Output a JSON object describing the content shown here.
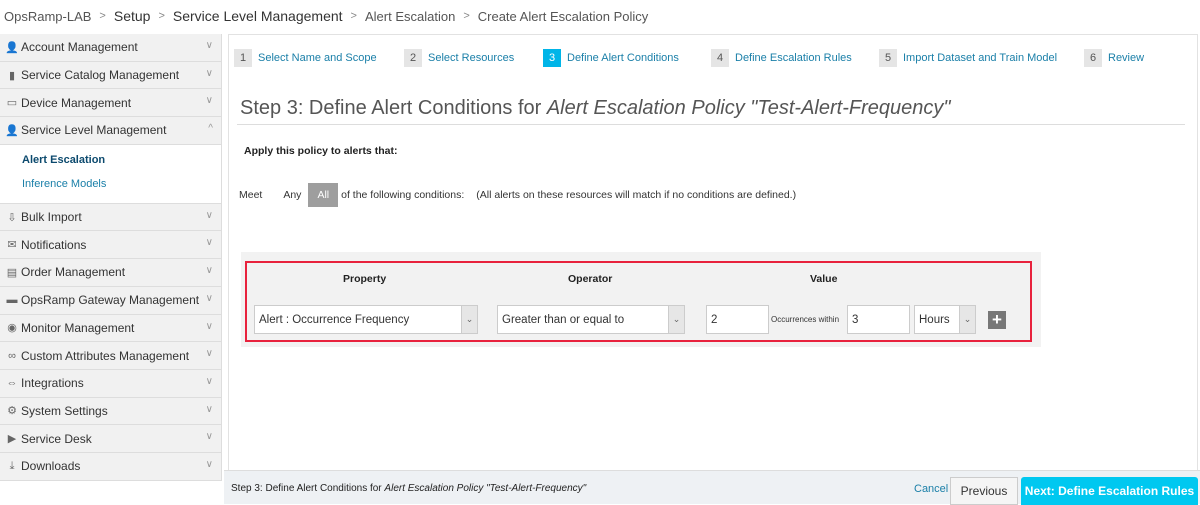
{
  "breadcrumb": [
    "OpsRamp-LAB",
    "Setup",
    "Service Level Management",
    "Alert Escalation",
    "Create Alert Escalation Policy"
  ],
  "sidebar": {
    "items": [
      {
        "label": "Account Management",
        "icon": "user-icon",
        "expanded": false
      },
      {
        "label": "Service Catalog Management",
        "icon": "document-icon",
        "expanded": false
      },
      {
        "label": "Device Management",
        "icon": "monitor-icon",
        "expanded": false
      },
      {
        "label": "Service Level Management",
        "icon": "user-icon",
        "expanded": true
      },
      {
        "label": "Bulk Import",
        "icon": "import-icon",
        "expanded": false
      },
      {
        "label": "Notifications",
        "icon": "envelope-icon",
        "expanded": false
      },
      {
        "label": "Order Management",
        "icon": "book-icon",
        "expanded": false
      },
      {
        "label": "OpsRamp Gateway Management",
        "icon": "gateway-icon",
        "expanded": false
      },
      {
        "label": "Monitor Management",
        "icon": "eye-icon",
        "expanded": false
      },
      {
        "label": "Custom Attributes Management",
        "icon": "infinity-icon",
        "expanded": false
      },
      {
        "label": "Integrations",
        "icon": "arrows-icon",
        "expanded": false
      },
      {
        "label": "System Settings",
        "icon": "gear-icon",
        "expanded": false
      },
      {
        "label": "Service Desk",
        "icon": "tag-icon",
        "expanded": false
      },
      {
        "label": "Downloads",
        "icon": "download-icon",
        "expanded": false
      }
    ],
    "subitems": [
      {
        "label": "Alert Escalation",
        "active": true
      },
      {
        "label": "Inference Models",
        "active": false
      }
    ]
  },
  "steps": [
    {
      "n": "1",
      "label": "Select Name and Scope"
    },
    {
      "n": "2",
      "label": "Select Resources"
    },
    {
      "n": "3",
      "label": "Define Alert Conditions",
      "active": true
    },
    {
      "n": "4",
      "label": "Define Escalation Rules"
    },
    {
      "n": "5",
      "label": "Import Dataset and Train Model"
    },
    {
      "n": "6",
      "label": "Review"
    }
  ],
  "title": {
    "prefix": "Step 3: Define Alert Conditions for ",
    "policy": "Alert Escalation Policy \"Test-Alert-Frequency\""
  },
  "apply": "Apply this policy to alerts that:",
  "meet": {
    "label": "Meet",
    "any": "Any",
    "all": "All",
    "selected": "All",
    "suffix": "of the following conditions:",
    "note": "(All alerts on these resources will match if no conditions are defined.)"
  },
  "conditions": {
    "headers": {
      "property": "Property",
      "operator": "Operator",
      "value": "Value"
    },
    "property": "Alert : Occurrence Frequency",
    "operator": "Greater than or equal to",
    "occurrences": "2",
    "within_label": "Occurrences within",
    "duration": "3",
    "unit": "Hours"
  },
  "footer": {
    "prefix": "Step 3: Define Alert Conditions for ",
    "policy": "Alert Escalation Policy \"Test-Alert-Frequency\"",
    "cancel": "Cancel",
    "previous": "Previous",
    "next": "Next: Define Escalation Rules"
  },
  "colors": {
    "accent": "#00c8f0",
    "highlight": "#e8223d",
    "link": "#1a7fa8"
  }
}
